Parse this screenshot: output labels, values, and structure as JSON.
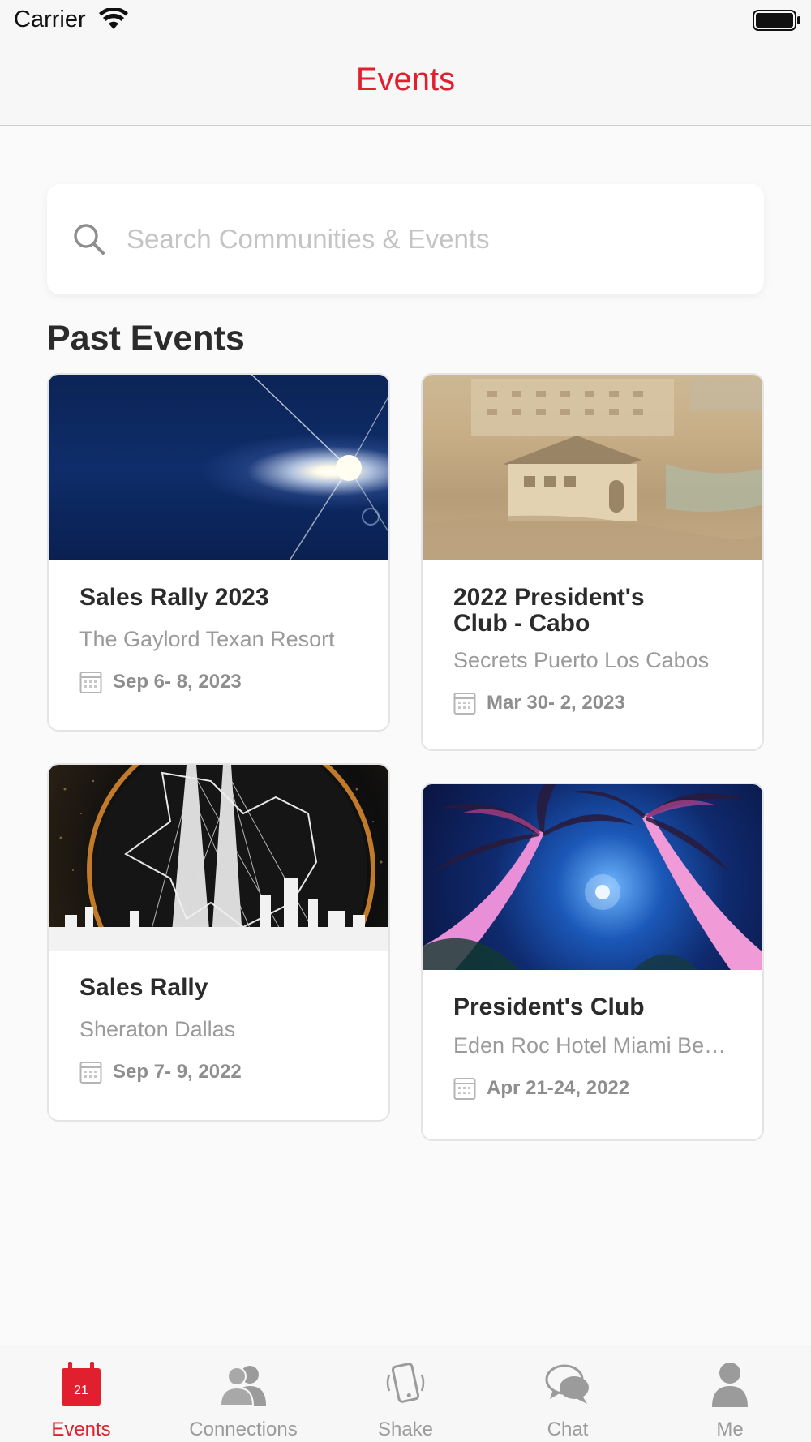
{
  "status_bar": {
    "carrier": "Carrier"
  },
  "nav": {
    "title": "Events"
  },
  "search": {
    "placeholder": "Search Communities & Events",
    "value": ""
  },
  "section": {
    "title": "Past Events"
  },
  "events": [
    {
      "title": "Sales Rally 2023",
      "venue": "The Gaylord Texan Resort",
      "date": "Sep  6- 8, 2023",
      "image": "lens-flare"
    },
    {
      "title": "2022 President's Club - Cabo",
      "venue": "Secrets Puerto Los Cabos",
      "date": "Mar 30- 2, 2023",
      "image": "resort-pool"
    },
    {
      "title": "Sales Rally",
      "venue": "Sheraton Dallas",
      "date": "Sep  7- 9, 2022",
      "image": "dallas-skyline"
    },
    {
      "title": "President's Club",
      "venue": "Eden Roc Hotel Miami Beac...",
      "date": "Apr 21-24, 2022",
      "image": "palm-trees-night"
    }
  ],
  "tabs": [
    {
      "label": "Events",
      "icon": "calendar-icon",
      "active": true,
      "badge": "21"
    },
    {
      "label": "Connections",
      "icon": "people-icon",
      "active": false
    },
    {
      "label": "Shake",
      "icon": "phone-shake-icon",
      "active": false
    },
    {
      "label": "Chat",
      "icon": "chat-bubble-icon",
      "active": false
    },
    {
      "label": "Me",
      "icon": "person-icon",
      "active": false
    }
  ],
  "colors": {
    "accent": "#e0202e",
    "inactive": "#9b9b9b"
  }
}
